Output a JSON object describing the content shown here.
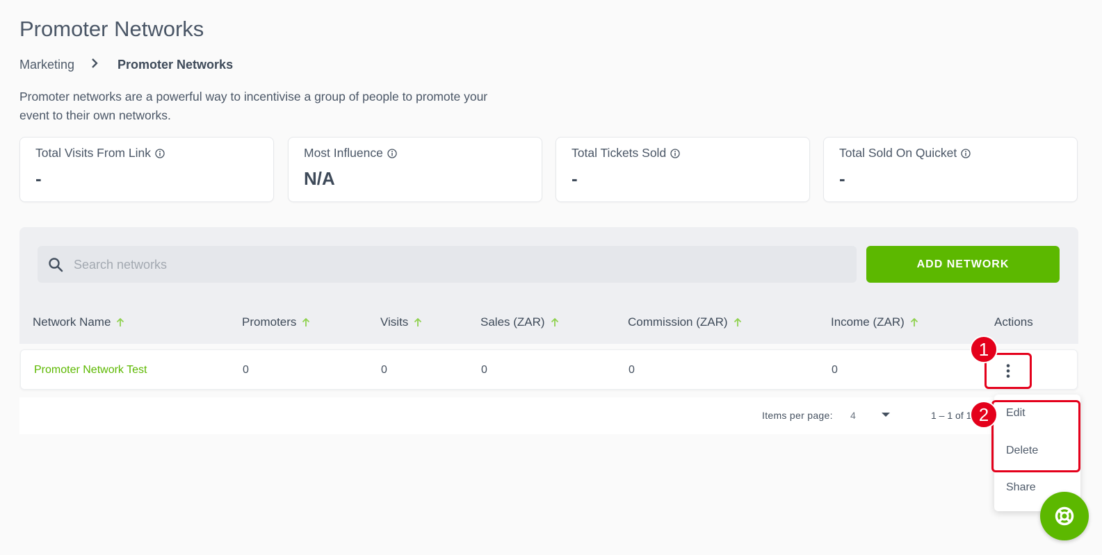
{
  "page": {
    "title": "Promoter Networks"
  },
  "breadcrumb": {
    "parent": "Marketing",
    "separator": "›",
    "current": "Promoter Networks"
  },
  "description": "Promoter networks are a powerful way to incentivise a group of people to promote your event to their own networks.",
  "stats": [
    {
      "label": "Total Visits From Link",
      "value": "-"
    },
    {
      "label": "Most Influence",
      "value": "N/A"
    },
    {
      "label": "Total Tickets Sold",
      "value": "-"
    },
    {
      "label": "Total Sold On Quicket",
      "value": "-"
    }
  ],
  "search": {
    "placeholder": "Search networks"
  },
  "toolbar": {
    "add_label": "ADD NETWORK"
  },
  "table": {
    "columns": [
      "Network Name",
      "Promoters",
      "Visits",
      "Sales (ZAR)",
      "Commission (ZAR)",
      "Income (ZAR)",
      "Actions"
    ],
    "rows": [
      {
        "name": "Promoter Network Test",
        "promoters": "0",
        "visits": "0",
        "sales": "0",
        "commission": "0",
        "income": "0"
      }
    ]
  },
  "pagination": {
    "items_per_page_label": "Items per page:",
    "items_per_page": "4",
    "range": "1 – 1 of 1"
  },
  "menu": {
    "items": [
      "Edit",
      "Delete",
      "Share"
    ]
  },
  "annotations": {
    "badge1": "1",
    "badge2": "2"
  },
  "colors": {
    "accent": "#5cb800",
    "highlight": "#e4001b",
    "text": "#44505f"
  }
}
